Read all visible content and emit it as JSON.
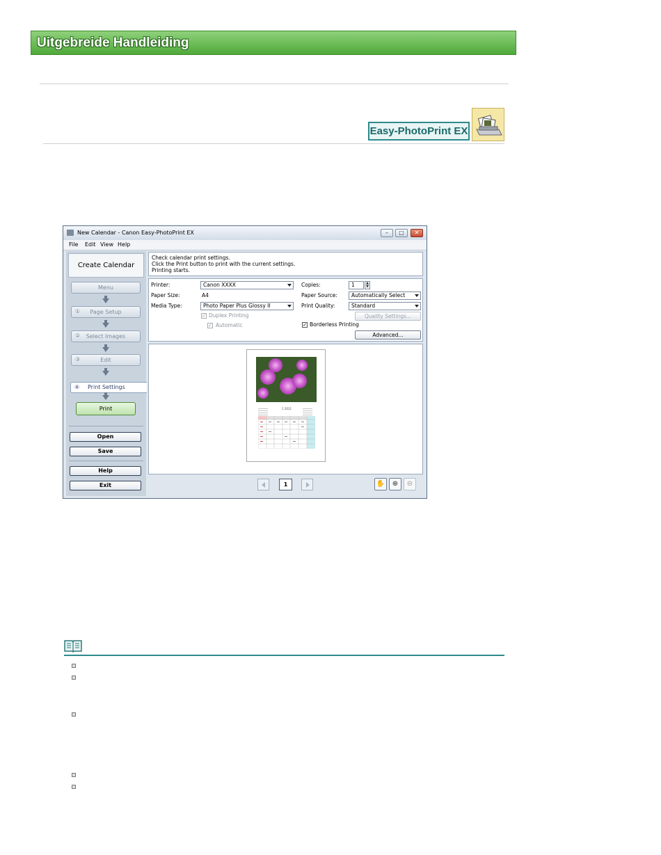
{
  "page": {
    "banner_title": "Uitgebreide Handleiding",
    "brand_label": "Easy-PhotoPrint EX"
  },
  "window": {
    "title": "New Calendar - Canon Easy-PhotoPrint EX",
    "menu": [
      "File",
      "Edit",
      "View",
      "Help"
    ],
    "sidebar": {
      "title": "Create Calendar",
      "menu_label": "Menu",
      "steps": [
        {
          "num": "①",
          "label": "Page Setup"
        },
        {
          "num": "②",
          "label": "Select Images"
        },
        {
          "num": "③",
          "label": "Edit"
        },
        {
          "num": "④",
          "label": "Print Settings"
        }
      ],
      "print_label": "Print",
      "open_label": "Open",
      "save_label": "Save",
      "help_label": "Help",
      "exit_label": "Exit"
    },
    "instructions": [
      "Check calendar print settings.",
      "Click the Print button to print with the current settings.",
      "Printing starts."
    ],
    "settings": {
      "printer_label": "Printer:",
      "printer_value": "Canon XXXX",
      "paper_size_label": "Paper Size:",
      "paper_size_value": "A4",
      "media_type_label": "Media Type:",
      "media_type_value": "Photo Paper Plus Glossy II",
      "copies_label": "Copies:",
      "copies_value": "1",
      "paper_source_label": "Paper Source:",
      "paper_source_value": "Automatically Select",
      "print_quality_label": "Print Quality:",
      "print_quality_value": "Standard",
      "duplex_label": "Duplex Printing",
      "automatic_label": "Automatic",
      "borderless_label": "Borderless Printing",
      "quality_settings_label": "Quality Settings...",
      "advanced_label": "Advanced..."
    },
    "preview": {
      "calendar_title": "1 2011",
      "page_number": "1"
    }
  }
}
